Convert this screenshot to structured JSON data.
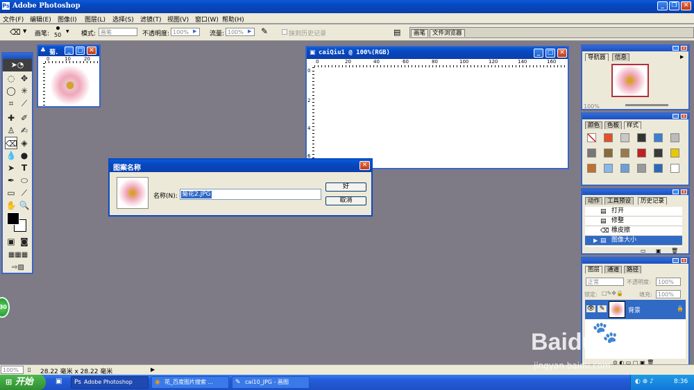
{
  "app": {
    "title": "Adobe Photoshop"
  },
  "menu": [
    "文件(F)",
    "编辑(E)",
    "图像(I)",
    "图层(L)",
    "选择(S)",
    "滤镜(T)",
    "视图(V)",
    "窗口(W)",
    "帮助(H)"
  ],
  "options": {
    "brush_label": "画笔:",
    "brush_size": "50",
    "mode_label": "模式:",
    "mode_value": "画笔",
    "opacity_label": "不透明度:",
    "opacity_value": "100%",
    "flow_label": "流量:",
    "flow_value": "100%",
    "erase_history": "抹到历史记录"
  },
  "palette_well": {
    "tabs": [
      "画笔",
      "文件浏览器"
    ]
  },
  "doc_small": {
    "title": "菊.",
    "ruler_marks": [
      "0",
      "10",
      "20"
    ]
  },
  "doc_main": {
    "title": "caiQiu1 @ 100%(RGB)",
    "ruler_h": [
      "0",
      "20",
      "40",
      "60",
      "80",
      "100",
      "120",
      "140",
      "160"
    ],
    "ruler_v": [
      "0",
      "2",
      "4",
      "6"
    ]
  },
  "dialog": {
    "title": "图案名称",
    "name_label": "名称(N):",
    "name_value": "菊花2.JPG",
    "ok": "好",
    "cancel": "取消"
  },
  "navigator": {
    "tabs": [
      "导航器",
      "信息"
    ],
    "zoom": "100%"
  },
  "swatches": {
    "tabs": [
      "颜色",
      "色板",
      "样式"
    ],
    "styles": [
      "#ffffff",
      "#e0502a",
      "#c8c8c8",
      "#333333",
      "#3a7fd0",
      "#bbbbbb",
      "#777777",
      "#8a6a3a",
      "#9a7a4a",
      "#c02020",
      "#3a3a3a",
      "#e8c800",
      "#c07030",
      "#8ab8e8",
      "#6aa0d8",
      "#999999",
      "#2a6ab8",
      "#ffffff"
    ]
  },
  "history": {
    "tabs": [
      "动作",
      "工具预设",
      "历史记录"
    ],
    "items": [
      "打开",
      "修整",
      "橡皮擦",
      "图像大小"
    ],
    "selected": 3
  },
  "layers": {
    "tabs": [
      "图层",
      "通道",
      "路径"
    ],
    "blend": "正常",
    "opacity_label": "不透明度:",
    "opacity": "100%",
    "lock_label": "锁定:",
    "fill_label": "填充:",
    "fill": "100%",
    "layer_name": "背景"
  },
  "status": {
    "zoom": "100%",
    "info": "28.22 毫米 x 28.22 毫米"
  },
  "taskbar": {
    "start": "开始",
    "items": [
      "Adobe Photoshop",
      "花_百度图片搜索 ...",
      "cai10_JPG - 画图"
    ],
    "clock": "8:36"
  },
  "badge": "30",
  "watermark": {
    "brand": "Baidu",
    "cn": "经验",
    "url": "jingyan.baidu.com"
  },
  "colors": {
    "titlebar": "#0a5ad8",
    "workspace": "#7e7b86",
    "selection": "#316ac5",
    "taskbar": "#245edb",
    "start": "#3c9a3c"
  }
}
